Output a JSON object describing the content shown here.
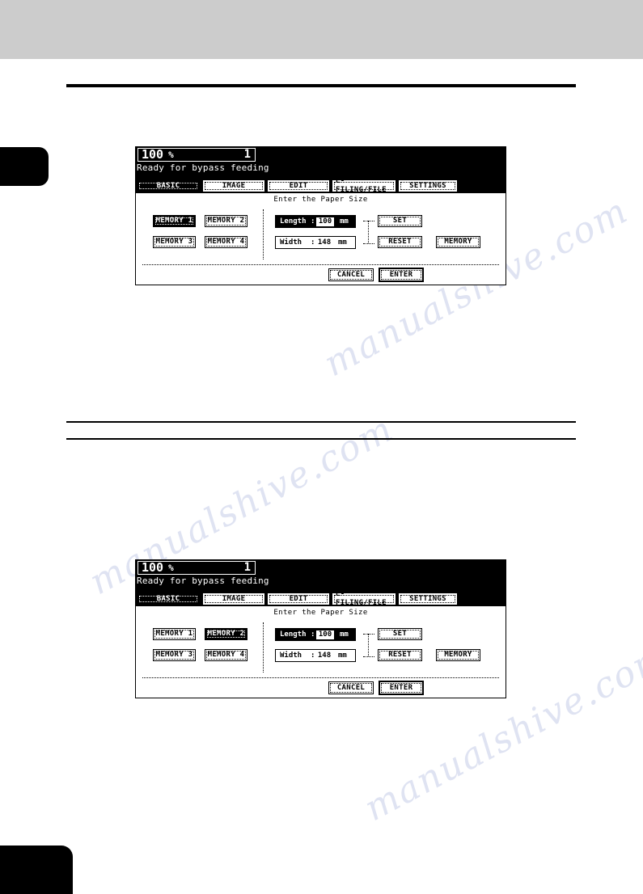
{
  "page": {
    "background_color": "#ffffff",
    "top_bar_color": "#cccccc",
    "rule_color": "#000000",
    "watermark_text_1": "manualshive.com",
    "watermark_text_2": "manualshive.com",
    "watermark_text_3": "manualshive.com"
  },
  "panels": [
    {
      "id": "panel-1",
      "header": {
        "zoom_ratio": "100",
        "percent_symbol": "%",
        "copy_count": "1",
        "status_message": "Ready for bypass feeding"
      },
      "tabs": [
        {
          "label": "BASIC",
          "selected": true
        },
        {
          "label": "IMAGE",
          "selected": false
        },
        {
          "label": "EDIT",
          "selected": false
        },
        {
          "label": "E-FILING/FILE",
          "selected": false
        },
        {
          "label": "SETTINGS",
          "selected": false
        }
      ],
      "prompt": "Enter the Paper Size",
      "memory_buttons": [
        {
          "label": "MEMORY 1",
          "selected": true
        },
        {
          "label": "MEMORY 2",
          "selected": false
        },
        {
          "label": "MEMORY 3",
          "selected": false
        },
        {
          "label": "MEMORY 4",
          "selected": false
        }
      ],
      "fields": {
        "length": {
          "label": "Length",
          "colon": ":",
          "value": "100",
          "unit": "mm",
          "active": true,
          "value_highlighted": true
        },
        "width": {
          "label": "Width",
          "colon": ":",
          "value": "148",
          "unit": "mm",
          "active": false,
          "value_highlighted": false
        }
      },
      "side_buttons": {
        "set": "SET",
        "reset": "RESET",
        "memory": "MEMORY"
      },
      "footer_buttons": {
        "cancel": "CANCEL",
        "enter": "ENTER"
      }
    },
    {
      "id": "panel-2",
      "header": {
        "zoom_ratio": "100",
        "percent_symbol": "%",
        "copy_count": "1",
        "status_message": "Ready for bypass feeding"
      },
      "tabs": [
        {
          "label": "BASIC",
          "selected": true
        },
        {
          "label": "IMAGE",
          "selected": false
        },
        {
          "label": "EDIT",
          "selected": false
        },
        {
          "label": "E-FILING/FILE",
          "selected": false
        },
        {
          "label": "SETTINGS",
          "selected": false
        }
      ],
      "prompt": "Enter the Paper Size",
      "memory_buttons": [
        {
          "label": "MEMORY 1",
          "selected": false
        },
        {
          "label": "MEMORY 2",
          "selected": true
        },
        {
          "label": "MEMORY 3",
          "selected": false
        },
        {
          "label": "MEMORY 4",
          "selected": false
        }
      ],
      "fields": {
        "length": {
          "label": "Length",
          "colon": ":",
          "value": "100",
          "unit": "mm",
          "active": true,
          "value_highlighted": true
        },
        "width": {
          "label": "Width",
          "colon": ":",
          "value": "148",
          "unit": "mm",
          "active": false,
          "value_highlighted": false
        }
      },
      "side_buttons": {
        "set": "SET",
        "reset": "RESET",
        "memory": "MEMORY"
      },
      "footer_buttons": {
        "cancel": "CANCEL",
        "enter": "ENTER"
      }
    }
  ]
}
